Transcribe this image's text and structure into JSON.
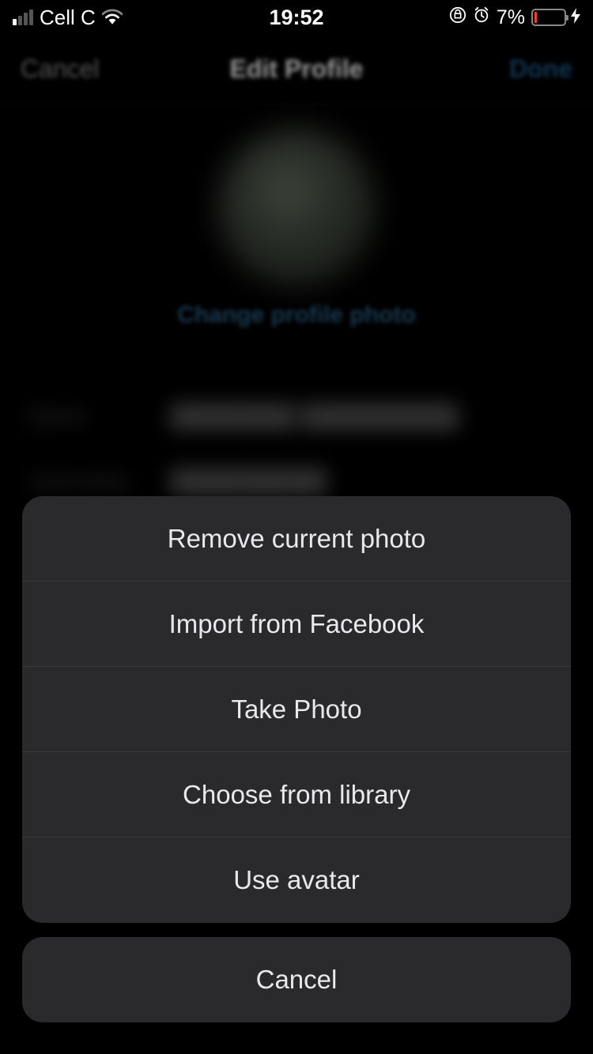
{
  "statusBar": {
    "carrier": "Cell C",
    "time": "19:52",
    "batteryPercent": "7%"
  },
  "nav": {
    "cancel": "Cancel",
    "title": "Edit Profile",
    "done": "Done"
  },
  "profile": {
    "changePhotoLabel": "Change profile photo"
  },
  "actionSheet": {
    "items": [
      "Remove current photo",
      "Import from Facebook",
      "Take Photo",
      "Choose from library",
      "Use avatar"
    ],
    "cancel": "Cancel"
  }
}
